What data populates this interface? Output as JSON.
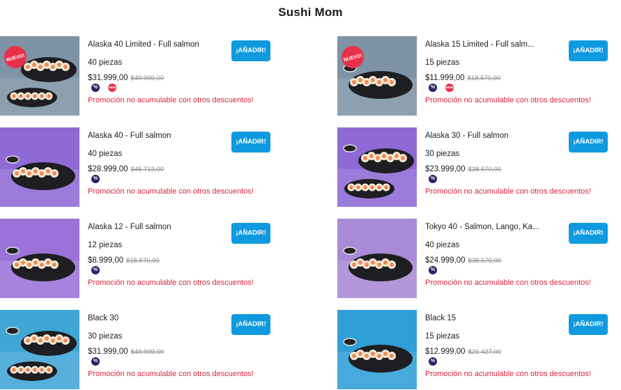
{
  "store": {
    "title": "Sushi Mom"
  },
  "products": [
    {
      "name": "Alaska 40 Limited - Full salmon",
      "pieces": "40 piezas",
      "price": "$31.999,00",
      "old_price": "$49.999,00",
      "add_label": "¡AÑADIR!",
      "promo": "Promoción no acumulable con otros descuentos!",
      "badges": [
        "percent-icon",
        "new-icon"
      ],
      "sticker": "NUEVO!",
      "photo_bg": "#7e93a6"
    },
    {
      "name": "Alaska 15 Limited - Full salm...",
      "pieces": "15 piezas",
      "price": "$11.999,00",
      "old_price": "$18.570,00",
      "add_label": "¡AÑADIR!",
      "promo": "Promoción no acumulable con otros descuentos!",
      "badges": [
        "percent-icon",
        "new-icon"
      ],
      "sticker": "NUEVO!",
      "photo_bg": "#7e93a6"
    },
    {
      "name": "Alaska 40 - Full salmon",
      "pieces": "40 piezas",
      "price": "$28.999,00",
      "old_price": "$45.713,00",
      "add_label": "¡AÑADIR!",
      "promo": "Promoción no acumulable con otros descuentos!",
      "badges": [
        "percent-icon"
      ],
      "photo_bg": "#8f6ad6"
    },
    {
      "name": "Alaska 30 - Full salmon",
      "pieces": "30 piezas",
      "price": "$23.999,00",
      "old_price": "$38.570,00",
      "add_label": "¡AÑADIR!",
      "promo": "Promoción no acumulable con otros descuentos!",
      "badges": [
        "percent-icon"
      ],
      "photo_bg": "#8f6ad6"
    },
    {
      "name": "Alaska 12 - Full salmon",
      "pieces": "12 piezas",
      "price": "$8.999,00",
      "old_price": "$15.570,00",
      "add_label": "¡AÑADIR!",
      "promo": "Promoción no acumulable con otros descuentos!",
      "badges": [
        "percent-icon"
      ],
      "photo_bg": "#9a72d8"
    },
    {
      "name": "Tokyo 40 - Salmon, Lango, Ka...",
      "pieces": "40 piezas",
      "price": "$24.999,00",
      "old_price": "$38.570,00",
      "add_label": "¡AÑADIR!",
      "promo": "Promoción no acumulable con otros descuentos!",
      "badges": [
        "percent-icon"
      ],
      "photo_bg": "#a88ad6"
    },
    {
      "name": "Black 30",
      "pieces": "30 piezas",
      "price": "$31.999,00",
      "old_price": "$49.999,00",
      "add_label": "¡AÑADIR!",
      "promo": "Promoción no acumulable con otros descuentos!",
      "badges": [
        "percent-icon"
      ],
      "photo_bg": "#3fa6d6"
    },
    {
      "name": "Black 15",
      "pieces": "15 piezas",
      "price": "$12.999,00",
      "old_price": "$21.427,00",
      "add_label": "¡AÑADIR!",
      "promo": "Promoción no acumulable con otros descuentos!",
      "badges": [
        "percent-icon"
      ],
      "photo_bg": "#2f9fd8"
    }
  ],
  "colors": {
    "accent": "#0f9ae0",
    "promo": "#d8243a",
    "badge_percent": "#2a2266",
    "badge_new": "#e8304a"
  }
}
